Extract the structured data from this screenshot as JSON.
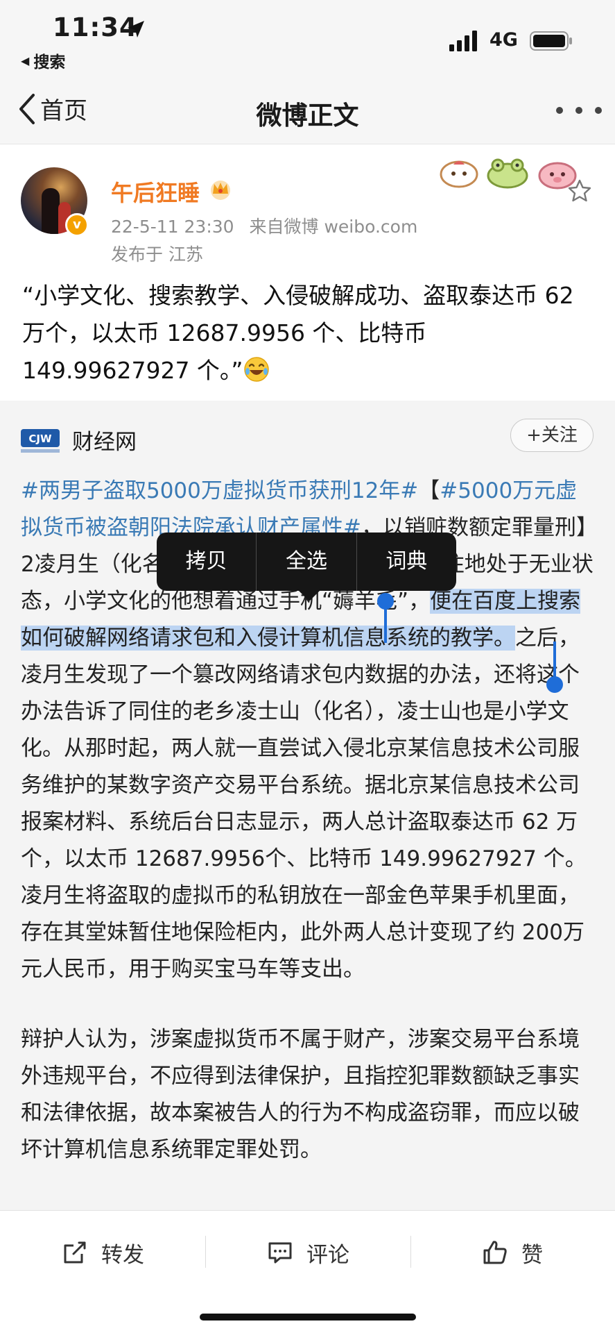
{
  "status_bar": {
    "time": "11:34",
    "back_app": "搜索",
    "network": "4G"
  },
  "nav": {
    "back_label": "首页",
    "title": "微博正文"
  },
  "post": {
    "username": "午后狂睡",
    "date": "22-5-11 23:30",
    "source": "来自微博 weibo.com",
    "location": "发布于 江苏",
    "text": "“小学文化、搜索教学、入侵破解成功、盗取泰达币 62 万个，以太币 12687.9956 个、比特币 149.99627927 个。”"
  },
  "repost": {
    "source_name": "财经网",
    "follow_label": "+关注",
    "hashtag1": "#两男子盗取5000万虚拟货币获刑12年#",
    "bracket_open": "【",
    "hashtag2": "#5000万元虚拟货币被盗朝阳法院承认财产属性#",
    "p1_a": "，以销赃数额定罪量刑】2",
    "p1_b": "凌月生（化名）在广东省云浮市云城区某暂住地处于无业状态，小学文化的他想着通过手机“薅羊毛”，",
    "selected_text": "便在百度上搜索如何破解网络请求包和入侵计算机信息系统的教学。",
    "p1_c": "之后，凌月生发现了一个篡改网络请求包内数据的办法，还将这个办法告诉了同住的老乡凌士山（化名），凌士山也是小学文化。从那时起，两人就一直尝试入侵北京某信息技术公司服务维护的某数字资产交易平台系统。据北京某信息技术公司报案材料、系统后台日志显示，两人总计盗取泰达币 62 万个，以太币 12687.9956个、比特币 149.99627927 个。凌月生将盗取的虚拟币的私钥放在一部金色苹果手机里面，存在其堂妹暂住地保险柜内，此外两人总计变现了约 200万元人民币，用于购买宝马车等支出。",
    "p2": "辩护人认为，涉案虚拟货币不属于财产，涉案交易平台系境外违规平台，不应得到法律保护，且指控犯罪数额缺乏事实和法律依据，故本案被告人的行为不构成盗窃罪，而应以破坏计算机信息系统罪定罪处罚。"
  },
  "context_menu": {
    "copy": "拷贝",
    "select_all": "全选",
    "dictionary": "词典"
  },
  "actions": {
    "repost": "转发",
    "comment": "评论",
    "like": "赞"
  },
  "colors": {
    "username": "#f07a23",
    "hashtag": "#3a7ab5",
    "selection": "#bcd4f2",
    "handle": "#1f6dd8",
    "menu_bg": "#161616"
  }
}
